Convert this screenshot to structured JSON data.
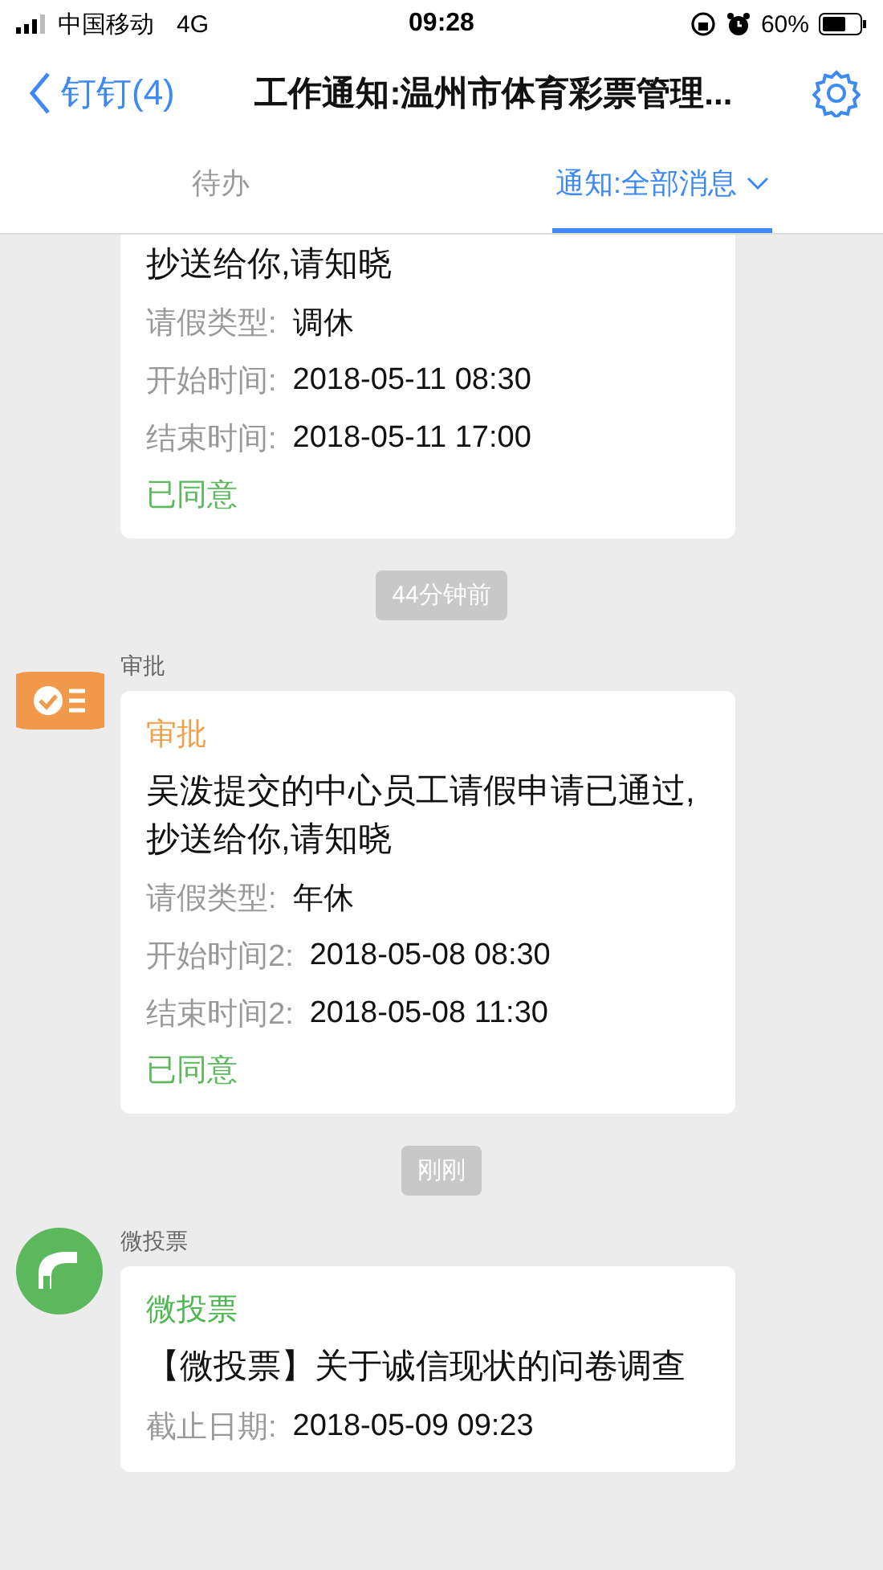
{
  "status_bar": {
    "carrier": "中国移动",
    "network": "4G",
    "time": "09:28",
    "battery": "60%"
  },
  "nav": {
    "back": "钉钉(4)",
    "title": "工作通知:温州市体育彩票管理..."
  },
  "tabs": [
    {
      "label": "待办",
      "selected": false
    },
    {
      "label": "通知:全部消息",
      "selected": true
    }
  ],
  "feed": [
    {
      "kind": "message",
      "body": "抄送给你,请知晓",
      "fields": [
        {
          "label": "请假类型:",
          "value": "调休"
        },
        {
          "label": "开始时间:",
          "value": "2018-05-11 08:30"
        },
        {
          "label": "结束时间:",
          "value": "2018-05-11 17:00"
        }
      ],
      "status": "已同意"
    },
    {
      "kind": "time",
      "text": "44分钟前"
    },
    {
      "kind": "approval",
      "sender": "审批",
      "title": "审批",
      "body": "吴泼提交的中心员工请假申请已通过,抄送给你,请知晓",
      "fields": [
        {
          "label": "请假类型:",
          "value": "年休"
        },
        {
          "label": "开始时间2:",
          "value": "2018-05-08 08:30"
        },
        {
          "label": "结束时间2:",
          "value": "2018-05-08 11:30"
        }
      ],
      "status": "已同意"
    },
    {
      "kind": "time",
      "text": "刚刚"
    },
    {
      "kind": "vote",
      "sender": "微投票",
      "title": "微投票",
      "body": "【微投票】关于诚信现状的问卷调查",
      "fields": [
        {
          "label": "截止日期:",
          "value": "2018-05-09 09:23"
        }
      ]
    }
  ]
}
